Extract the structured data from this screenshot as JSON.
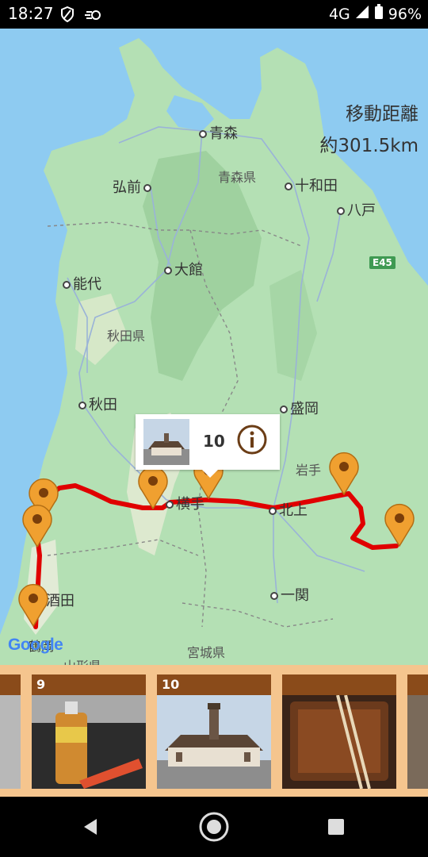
{
  "status_bar": {
    "time": "18:27",
    "network": "4G",
    "battery": "96%"
  },
  "map": {
    "distance_title": "移動距離",
    "distance_value": "約301.5km",
    "highway_label": "E45",
    "cities": {
      "aomori": "青森",
      "hirosaki": "弘前",
      "towada": "十和田",
      "hachinohe": "八戸",
      "odate": "大館",
      "noshiro": "能代",
      "akita": "秋田",
      "morioka": "盛岡",
      "yokote": "横手",
      "kitakami": "北上",
      "ichinoseki": "一関",
      "sakata": "酒田",
      "tsuruoka": "鶴岡",
      "yamagata_partial": "山形県"
    },
    "prefectures": {
      "aomori_pref": "青森県",
      "akita_pref": "秋田県",
      "iwate_pref": "岩手",
      "miyagi_pref": "宮城県"
    },
    "popup": {
      "number": "10"
    },
    "google": "Google"
  },
  "photo_strip": {
    "cards": [
      {
        "label": ""
      },
      {
        "label": "9"
      },
      {
        "label": "10"
      },
      {
        "label": ""
      },
      {
        "label": ""
      }
    ]
  },
  "colors": {
    "route": "#e00000",
    "pin": "#f0a030",
    "strip_bg": "#f5c58e",
    "card_header": "#8a4b1a"
  }
}
